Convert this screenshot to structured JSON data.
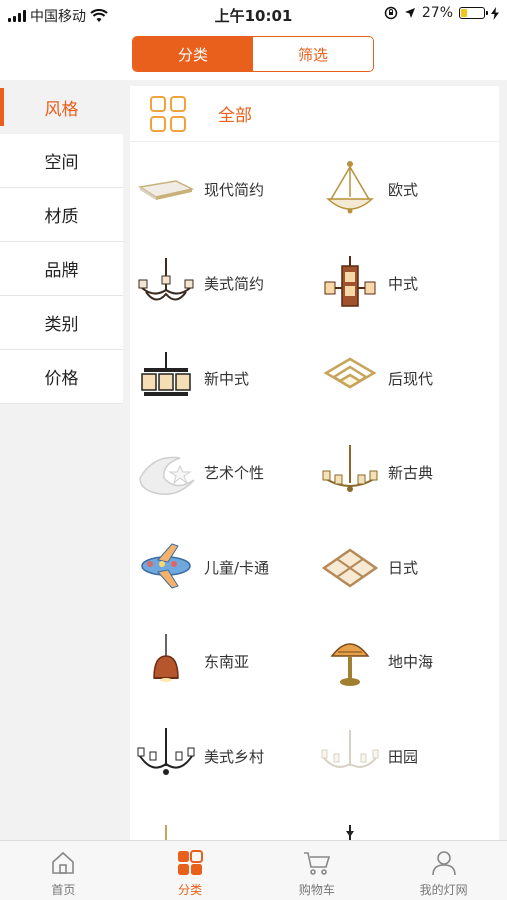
{
  "status_bar": {
    "carrier": "中国移动",
    "time": "上午10:01",
    "battery_percent": "27%",
    "battery_level": 0.27,
    "icons": [
      "signal-icon",
      "wifi-icon",
      "rotation-lock-icon",
      "location-icon",
      "battery-icon",
      "charging-icon"
    ]
  },
  "header": {
    "tabs": [
      {
        "label": "分类",
        "active": true
      },
      {
        "label": "筛选",
        "active": false
      }
    ]
  },
  "sidebar": {
    "items": [
      {
        "label": "风格",
        "active": true
      },
      {
        "label": "空间",
        "active": false
      },
      {
        "label": "材质",
        "active": false
      },
      {
        "label": "品牌",
        "active": false
      },
      {
        "label": "类别",
        "active": false
      },
      {
        "label": "价格",
        "active": false
      }
    ]
  },
  "content": {
    "all_label": "全部",
    "categories": [
      {
        "label": "现代简约",
        "icon": "ceiling-panel-lamp"
      },
      {
        "label": "欧式",
        "icon": "pendant-bowl-lamp"
      },
      {
        "label": "美式简约",
        "icon": "iron-chandelier"
      },
      {
        "label": "中式",
        "icon": "chinese-lantern-chandelier"
      },
      {
        "label": "新中式",
        "icon": "new-chinese-chandelier"
      },
      {
        "label": "后现代",
        "icon": "square-ring-lamp"
      },
      {
        "label": "艺术个性",
        "icon": "moon-star-lamp"
      },
      {
        "label": "新古典",
        "icon": "neoclassical-chandelier"
      },
      {
        "label": "儿童/卡通",
        "icon": "airplane-lamp"
      },
      {
        "label": "日式",
        "icon": "wooden-square-lamp"
      },
      {
        "label": "东南亚",
        "icon": "rattan-pendant"
      },
      {
        "label": "地中海",
        "icon": "tiffany-table-lamp"
      },
      {
        "label": "美式乡村",
        "icon": "country-chandelier"
      },
      {
        "label": "田园",
        "icon": "white-candle-chandelier"
      }
    ]
  },
  "tabbar": {
    "items": [
      {
        "label": "首页",
        "icon": "home-icon",
        "active": false
      },
      {
        "label": "分类",
        "icon": "category-icon",
        "active": true
      },
      {
        "label": "购物车",
        "icon": "cart-icon",
        "active": false
      },
      {
        "label": "我的灯网",
        "icon": "user-icon",
        "active": false
      }
    ]
  },
  "colors": {
    "accent": "#e8601c",
    "accent_light": "#f0a23c",
    "background": "#f2f2f2"
  }
}
